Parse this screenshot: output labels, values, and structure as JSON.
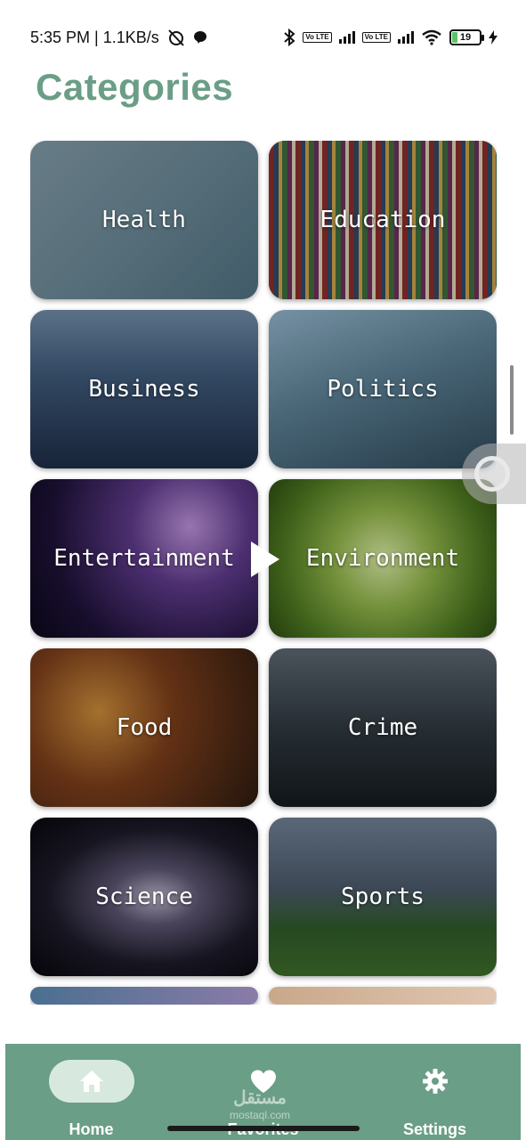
{
  "status_bar": {
    "time_speed": "5:35 PM | 1.1KB/s",
    "volte_1": "Vo LTE",
    "volte_2": "Vo LTE",
    "battery": "19"
  },
  "page": {
    "title": "Categories"
  },
  "categories": [
    {
      "label": "Health"
    },
    {
      "label": "Education"
    },
    {
      "label": "Business"
    },
    {
      "label": "Politics"
    },
    {
      "label": "Entertainment"
    },
    {
      "label": "Environment"
    },
    {
      "label": "Food"
    },
    {
      "label": "Crime"
    },
    {
      "label": "Science"
    },
    {
      "label": "Sports"
    }
  ],
  "bottom_nav": {
    "items": [
      {
        "label": "Home",
        "icon": "home-icon"
      },
      {
        "label": "Favorites",
        "icon": "heart-icon"
      },
      {
        "label": "Settings",
        "icon": "gear-icon"
      }
    ]
  },
  "watermark": {
    "text": "مستقل",
    "subtext": "mostaql.com"
  },
  "colors": {
    "accent": "#6a9e86",
    "active_pill": "#d7e9df"
  }
}
